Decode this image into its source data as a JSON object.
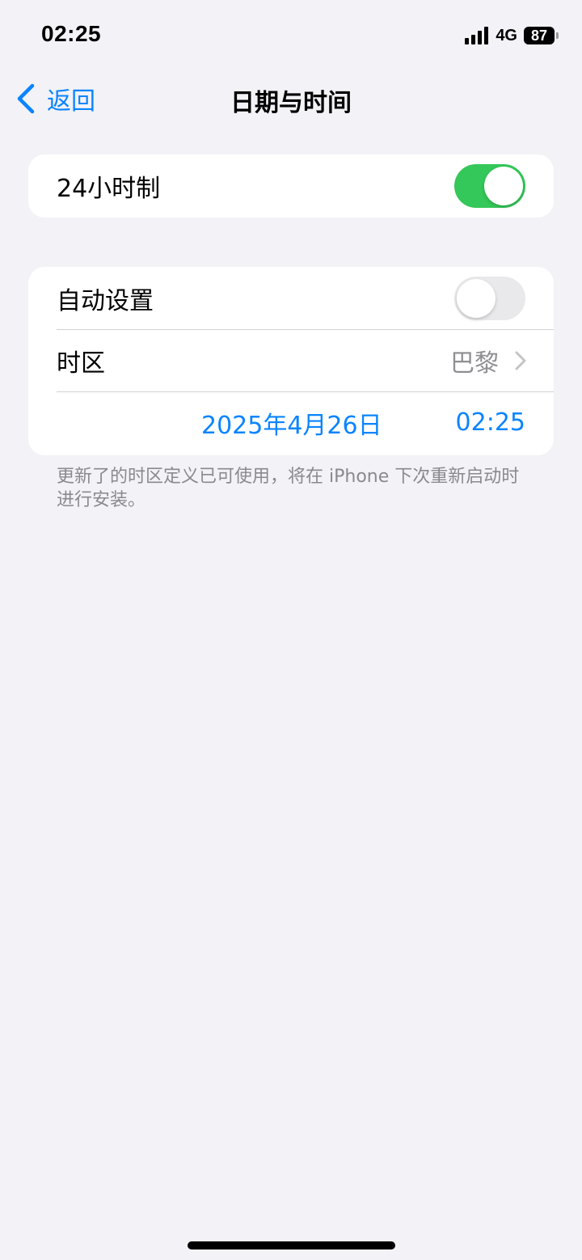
{
  "status_bar": {
    "time": "02:25",
    "network": "4G",
    "battery": "87",
    "icons": [
      "signal-icon",
      "battery-icon"
    ]
  },
  "nav": {
    "back_label": "返回",
    "back_icon": "chevron-left-icon",
    "title": "日期与时间"
  },
  "hour_format": {
    "label": "24小时制",
    "enabled": true
  },
  "auto_set": {
    "label": "自动设置",
    "enabled": false
  },
  "time_zone": {
    "label": "时区",
    "value": "巴黎",
    "icon": "chevron-right-icon"
  },
  "date_time": {
    "date": "2025年4月26日",
    "time": "02:25"
  },
  "footnote": "更新了的时区定义已可使用，将在 iPhone 下次重新启动时进行安装。",
  "colors": {
    "accent": "#0A84FF",
    "toggle_on": "#34C759",
    "toggle_off": "#E9E9EB",
    "background": "#F2F2F7"
  }
}
